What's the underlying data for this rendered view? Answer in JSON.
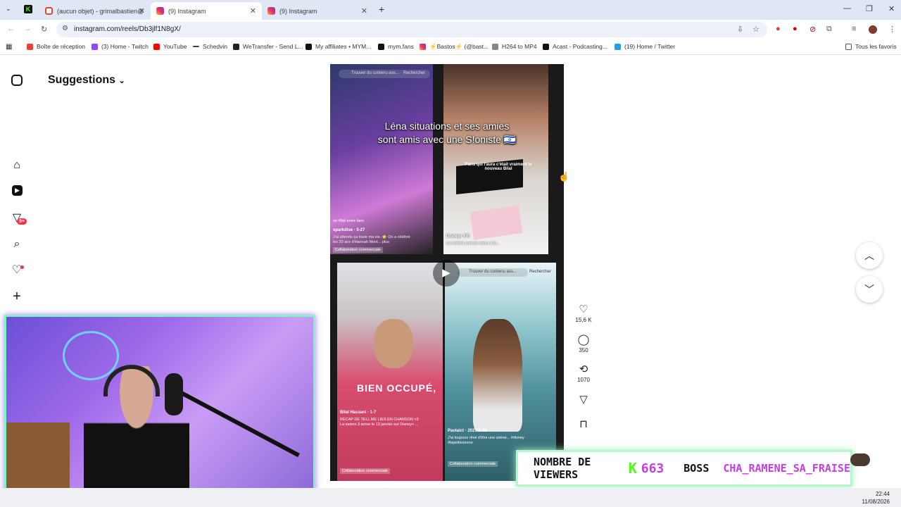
{
  "browser": {
    "tabs": [
      {
        "label": "(aucun objet) - grimalbastien@",
        "icon": "gmail-icon"
      },
      {
        "label": "(9) Instagram",
        "icon": "instagram-icon",
        "active": true
      },
      {
        "label": "(9) Instagram",
        "icon": "instagram-icon"
      }
    ],
    "url": "instagram.com/reels/Db3jlf1N8gX/",
    "bookmarks": [
      "Boîte de réception",
      "(3) Home - Twitch",
      "YouTube",
      "Schedvin",
      "WeTransfer - Send L...",
      "My affiliates • MYM...",
      "mym.fans",
      "⚡Bastos⚡ (@bast...",
      "H264 to MP4",
      "Acast - Podcasting...",
      "(19) Home / Twitter"
    ],
    "all_bookmarks": "Tous les favoris",
    "bookmark_colors": [
      "#ea4335",
      "#9146ff",
      "#ff0000",
      "#444",
      "#222",
      "#111",
      "#111",
      "#e1306c",
      "#888",
      "#111",
      "#1da1f2"
    ]
  },
  "sidebar": {
    "title": "Suggestions",
    "notif_badge": "9+"
  },
  "reel": {
    "caption_line1": "Léna situations et ses amies",
    "caption_line2": "sont amis avec une S!oniste 🇮🇱",
    "search_placeholder": "Trouver du contenu ass...",
    "search_button": "Rechercher",
    "q1_user": "sparkdise · 5-27",
    "q1_text": "J'ai attendu ça toute ma vie..⭐ On a célébré les 20 ans d'Hannah Mont... plus",
    "q1_badge": "Collaboration commerciale",
    "q1_tag": "on #fait entre fans",
    "q2_user": "Disney+ FR",
    "q2_text": "Les bébés sont de retour à la...",
    "q2_overlay": "Paris qui l'aura c'était vraiment le nouveau Bilal",
    "q3_user": "Bilal Hassani · 1-7",
    "q3_text": "RECAP DE TELL ME LIES EN CHANSON <3 La saison 3 arrive le 13 janvier sur Disney+ ...",
    "q3_banner": "BIEN OCCUPÉ,",
    "q3_badge": "Collaboration commerciale",
    "q4_user": "Paolaict · 2025-5-29",
    "q4_text": "J'ai toujours rêvé d'être une sirène... #disney #lapetitesirene",
    "q4_badge": "Collaboration commerciale"
  },
  "actions": {
    "likes": "15,6 K",
    "comments": "350",
    "reposts": "1070"
  },
  "stream": {
    "viewers_label": "NOMBRE DE VIEWERS",
    "viewers_count": "663",
    "boss_label": "BOSS",
    "boss_name": "CHA_RAMENE_SA_FRAISE",
    "kick_color": "#53fc18",
    "accent": "#c43ee0"
  },
  "clock": {
    "time": "22:44",
    "date": "11/08/2026"
  }
}
